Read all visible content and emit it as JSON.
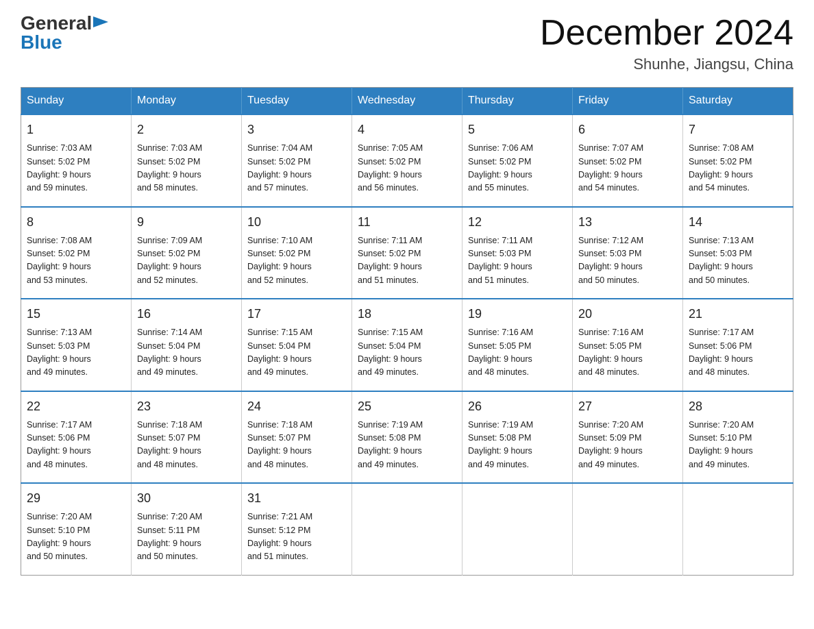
{
  "logo": {
    "general": "General",
    "blue": "Blue",
    "arrow": "▶"
  },
  "title": "December 2024",
  "location": "Shunhe, Jiangsu, China",
  "days_header": [
    "Sunday",
    "Monday",
    "Tuesday",
    "Wednesday",
    "Thursday",
    "Friday",
    "Saturday"
  ],
  "weeks": [
    [
      {
        "day": "1",
        "sunrise": "7:03 AM",
        "sunset": "5:02 PM",
        "daylight": "9 hours and 59 minutes."
      },
      {
        "day": "2",
        "sunrise": "7:03 AM",
        "sunset": "5:02 PM",
        "daylight": "9 hours and 58 minutes."
      },
      {
        "day": "3",
        "sunrise": "7:04 AM",
        "sunset": "5:02 PM",
        "daylight": "9 hours and 57 minutes."
      },
      {
        "day": "4",
        "sunrise": "7:05 AM",
        "sunset": "5:02 PM",
        "daylight": "9 hours and 56 minutes."
      },
      {
        "day": "5",
        "sunrise": "7:06 AM",
        "sunset": "5:02 PM",
        "daylight": "9 hours and 55 minutes."
      },
      {
        "day": "6",
        "sunrise": "7:07 AM",
        "sunset": "5:02 PM",
        "daylight": "9 hours and 54 minutes."
      },
      {
        "day": "7",
        "sunrise": "7:08 AM",
        "sunset": "5:02 PM",
        "daylight": "9 hours and 54 minutes."
      }
    ],
    [
      {
        "day": "8",
        "sunrise": "7:08 AM",
        "sunset": "5:02 PM",
        "daylight": "9 hours and 53 minutes."
      },
      {
        "day": "9",
        "sunrise": "7:09 AM",
        "sunset": "5:02 PM",
        "daylight": "9 hours and 52 minutes."
      },
      {
        "day": "10",
        "sunrise": "7:10 AM",
        "sunset": "5:02 PM",
        "daylight": "9 hours and 52 minutes."
      },
      {
        "day": "11",
        "sunrise": "7:11 AM",
        "sunset": "5:02 PM",
        "daylight": "9 hours and 51 minutes."
      },
      {
        "day": "12",
        "sunrise": "7:11 AM",
        "sunset": "5:03 PM",
        "daylight": "9 hours and 51 minutes."
      },
      {
        "day": "13",
        "sunrise": "7:12 AM",
        "sunset": "5:03 PM",
        "daylight": "9 hours and 50 minutes."
      },
      {
        "day": "14",
        "sunrise": "7:13 AM",
        "sunset": "5:03 PM",
        "daylight": "9 hours and 50 minutes."
      }
    ],
    [
      {
        "day": "15",
        "sunrise": "7:13 AM",
        "sunset": "5:03 PM",
        "daylight": "9 hours and 49 minutes."
      },
      {
        "day": "16",
        "sunrise": "7:14 AM",
        "sunset": "5:04 PM",
        "daylight": "9 hours and 49 minutes."
      },
      {
        "day": "17",
        "sunrise": "7:15 AM",
        "sunset": "5:04 PM",
        "daylight": "9 hours and 49 minutes."
      },
      {
        "day": "18",
        "sunrise": "7:15 AM",
        "sunset": "5:04 PM",
        "daylight": "9 hours and 49 minutes."
      },
      {
        "day": "19",
        "sunrise": "7:16 AM",
        "sunset": "5:05 PM",
        "daylight": "9 hours and 48 minutes."
      },
      {
        "day": "20",
        "sunrise": "7:16 AM",
        "sunset": "5:05 PM",
        "daylight": "9 hours and 48 minutes."
      },
      {
        "day": "21",
        "sunrise": "7:17 AM",
        "sunset": "5:06 PM",
        "daylight": "9 hours and 48 minutes."
      }
    ],
    [
      {
        "day": "22",
        "sunrise": "7:17 AM",
        "sunset": "5:06 PM",
        "daylight": "9 hours and 48 minutes."
      },
      {
        "day": "23",
        "sunrise": "7:18 AM",
        "sunset": "5:07 PM",
        "daylight": "9 hours and 48 minutes."
      },
      {
        "day": "24",
        "sunrise": "7:18 AM",
        "sunset": "5:07 PM",
        "daylight": "9 hours and 48 minutes."
      },
      {
        "day": "25",
        "sunrise": "7:19 AM",
        "sunset": "5:08 PM",
        "daylight": "9 hours and 49 minutes."
      },
      {
        "day": "26",
        "sunrise": "7:19 AM",
        "sunset": "5:08 PM",
        "daylight": "9 hours and 49 minutes."
      },
      {
        "day": "27",
        "sunrise": "7:20 AM",
        "sunset": "5:09 PM",
        "daylight": "9 hours and 49 minutes."
      },
      {
        "day": "28",
        "sunrise": "7:20 AM",
        "sunset": "5:10 PM",
        "daylight": "9 hours and 49 minutes."
      }
    ],
    [
      {
        "day": "29",
        "sunrise": "7:20 AM",
        "sunset": "5:10 PM",
        "daylight": "9 hours and 50 minutes."
      },
      {
        "day": "30",
        "sunrise": "7:20 AM",
        "sunset": "5:11 PM",
        "daylight": "9 hours and 50 minutes."
      },
      {
        "day": "31",
        "sunrise": "7:21 AM",
        "sunset": "5:12 PM",
        "daylight": "9 hours and 51 minutes."
      },
      null,
      null,
      null,
      null
    ]
  ],
  "label_sunrise": "Sunrise:",
  "label_sunset": "Sunset:",
  "label_daylight": "Daylight: 9 hours"
}
